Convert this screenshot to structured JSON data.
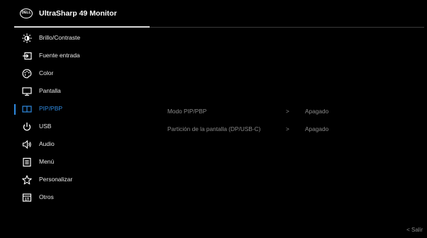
{
  "header": {
    "logo_text": "DELL",
    "title": "UltraSharp 49 Monitor"
  },
  "menu": {
    "items": [
      {
        "label": "Brillo/Contraste",
        "icon": "brightness-icon"
      },
      {
        "label": "Fuente entrada",
        "icon": "input-source-icon"
      },
      {
        "label": "Color",
        "icon": "color-palette-icon"
      },
      {
        "label": "Pantalla",
        "icon": "display-icon"
      },
      {
        "label": "PIP/PBP",
        "icon": "pip-pbp-icon"
      },
      {
        "label": "USB",
        "icon": "usb-icon"
      },
      {
        "label": "Audio",
        "icon": "audio-icon"
      },
      {
        "label": "Menú",
        "icon": "menu-icon"
      },
      {
        "label": "Personalizar",
        "icon": "star-icon"
      },
      {
        "label": "Otros",
        "icon": "others-icon"
      }
    ],
    "active_index": 4
  },
  "submenu": [
    {
      "label": "Modo PIP/PBP",
      "arrow": ">",
      "value": "Apagado"
    },
    {
      "label": "Partición de la pantalla (DP/USB-C)",
      "arrow": ">",
      "value": "Apagado"
    }
  ],
  "footer": {
    "exit_label": "Salir",
    "exit_arrow": "<"
  },
  "colors": {
    "accent": "#2f8ae0",
    "background": "#000000",
    "muted_text": "#8a8a8a"
  }
}
